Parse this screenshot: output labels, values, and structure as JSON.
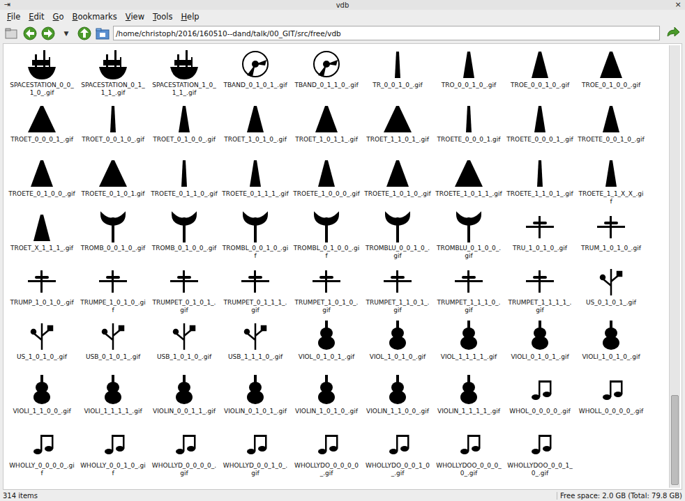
{
  "window": {
    "title": "vdb",
    "menu_glyph": "⇥",
    "close": "×"
  },
  "menu": [
    "File",
    "Edit",
    "Go",
    "Bookmarks",
    "View",
    "Tools",
    "Help"
  ],
  "toolbar": {
    "history_glyph": "▼",
    "path": "/home/christoph/2016/160510--dand/talk/00_GIT/src/free/vdb"
  },
  "files": [
    "SPACESTATION_0_0_1_0_.gif",
    "SPACESTATION_0_1_1_1_.gif",
    "SPACESTATION_1_0_1_1_.gif",
    "TBAND_0_1_0_1_.gif",
    "TBAND_0_1_1_0_.gif",
    "TR_0_0_1_0_.gif",
    "TRO_0_0_1_0_.gif",
    "TROE_0_0_1_0_.gif",
    "TROE_0_1_0_0_.gif",
    "TROET_0_0_0_1_.gif",
    "TROET_0_0_1_0_.gif",
    "TROET_0_1_0_0_.gif",
    "TROET_1_0_1_0_.gif",
    "TROET_1_0_1_1_.gif",
    "TROET_1_1_0_1_.gif",
    "TROETE_0_0_0_1.gif",
    "TROETE_0_0_0_1_.gif",
    "TROETE_0_0_1_0_.gif",
    "TROETE_0_1_0_0_.gif",
    "TROETE_0_1_0_1.gif",
    "TROETE_0_1_1_0_.gif",
    "TROETE_0_1_1_1_.gif",
    "TROETE_1_0_0_0_.gif",
    "TROETE_1_0_1_0_.gif",
    "TROETE_1_0_1_1_.gif",
    "TROETE_1_1_0_1_.gif",
    "TROETE_1_1_X_X_.gif",
    "TROET_X_1_1_1_.gif",
    "TROMB_0_0_1_0_.gif",
    "TROMB_0_1_0_0_.gif",
    "TROMBL_0_0_1_0_.gif",
    "TROMBL_0_1_0_0_.gif",
    "TROMBLU_0_0_1_0_.gif",
    "TROMBLU_0_1_0_0_.gif",
    "TRU_1_0_1_0_.gif",
    "TRUM_1_0_1_0_.gif",
    "TRUMP_1_0_1_0_.gif",
    "TRUMPE_1_0_1_0_.gif",
    "TRUMPET_0_1_0_1_.gif",
    "TRUMPET_0_1_1_1_.gif",
    "TRUMPET_1_0_1_0_.gif",
    "TRUMPET_1_1_0_1_.gif",
    "TRUMPET_1_1_1_0_.gif",
    "TRUMPET_1_1_1_1_.gif",
    "US_0_1_0_1_.gif",
    "US_1_0_1_0_.gif",
    "USB_0_1_0_1_.gif",
    "USB_1_0_1_0_.gif",
    "USB_1_1_1_0_.gif",
    "VIOL_0_1_0_1_.gif",
    "VIOL_1_0_1_0_.gif",
    "VIOL_1_1_1_1_.gif",
    "VIOLI_0_1_0_1_.gif",
    "VIOLI_1_0_1_0_.gif",
    "VIOLI_1_1_0_0_.gif",
    "VIOLI_1_1_1_1_.gif",
    "VIOLIN_0_0_1_1_.gif",
    "VIOLIN_0_1_0_1_.gif",
    "VIOLIN_1_0_1_0_.gif",
    "VIOLIN_1_1_0_0_.gif",
    "VIOLIN_1_1_1_1_.gif",
    "WHOL_0_0_0_0_.gif",
    "WHOLL_0_0_0_0_.gif",
    "WHOLLY_0_0_0_0_.gif",
    "WHOLLY_0_0_1_0_.gif",
    "WHOLLYD_0_0_0_0_.gif",
    "WHOLLYD_0_0_1_0_.gif",
    "WHOLLYDO_0_0_0_0_.gif",
    "WHOLLYDO_0_0_1_0_.gif",
    "WHOLLYDOO_0_0_0_0_.gif",
    "WHOLLYDOO_0_0_1_0_.gif"
  ],
  "scrollbar": {
    "thumb_start": 0.79,
    "thumb_size": 0.2
  },
  "status_bar": {
    "count": "314 items",
    "free_space": "Free space: 2.0 GB (Total: 79.8 GB)"
  }
}
